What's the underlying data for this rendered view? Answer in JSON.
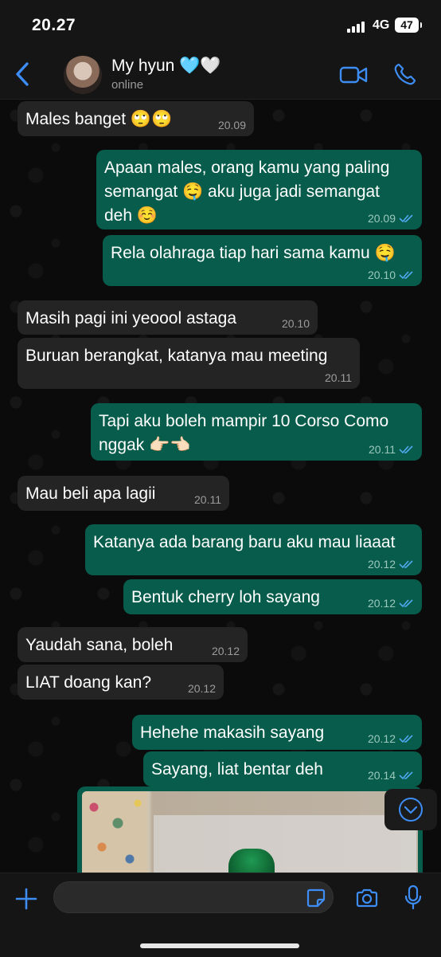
{
  "status_bar": {
    "time": "20.27",
    "network": "4G",
    "battery": "47"
  },
  "header": {
    "contact_name": "My hyun 🩵🤍",
    "contact_status": "online"
  },
  "messages": [
    {
      "dir": "in",
      "text": "Males banget 🙄🙄",
      "time": "20.09"
    },
    {
      "dir": "out",
      "text": "Apaan males, orang kamu yang paling\nsemangat 🤤 aku juga jadi semangat\ndeh ☺️",
      "time": "20.09",
      "read": true
    },
    {
      "dir": "out",
      "text": "Rela olahraga tiap hari sama kamu 🤤",
      "time": "20.10",
      "read": true
    },
    {
      "dir": "in",
      "text": "Masih pagi ini yeoool astaga",
      "time": "20.10"
    },
    {
      "dir": "in",
      "text": "Buruan berangkat, katanya mau meeting",
      "time": "20.11"
    },
    {
      "dir": "out",
      "text": "Tapi aku boleh mampir 10 Corso Como\nnggak 👉🏻👈🏻",
      "time": "20.11",
      "read": true
    },
    {
      "dir": "in",
      "text": "Mau beli apa lagii",
      "time": "20.11"
    },
    {
      "dir": "out",
      "text": "Katanya ada barang baru aku mau liaaat",
      "time": "20.12",
      "read": true
    },
    {
      "dir": "out",
      "text": "Bentuk cherry loh sayang",
      "time": "20.12",
      "read": true
    },
    {
      "dir": "in",
      "text": "Yaudah sana, boleh",
      "time": "20.12"
    },
    {
      "dir": "in",
      "text": "LIAT doang kan?",
      "time": "20.12"
    },
    {
      "dir": "out",
      "text": "Hehehe makasih sayang",
      "time": "20.12",
      "read": true
    },
    {
      "dir": "out",
      "text": "Sayang, liat bentar deh",
      "time": "20.14",
      "read": true
    }
  ],
  "colors": {
    "accent": "#3d8df5",
    "bubble_out": "#075c4b",
    "bubble_in": "#242424",
    "read_ticks": "#4fa8f0"
  },
  "icons": [
    "back-chevron-icon",
    "video-icon",
    "phone-icon",
    "plus-icon",
    "sticker-icon",
    "camera-icon",
    "mic-icon",
    "chevron-down-icon"
  ]
}
